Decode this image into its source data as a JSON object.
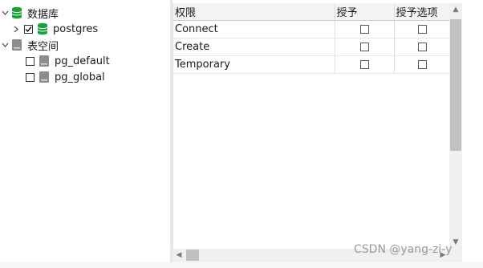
{
  "tree": {
    "databases": {
      "label": "数据库"
    },
    "postgres": {
      "label": "postgres",
      "checked": true
    },
    "tablespaces": {
      "label": "表空间"
    },
    "pg_default": {
      "label": "pg_default",
      "checked": false
    },
    "pg_global": {
      "label": "pg_global",
      "checked": false
    }
  },
  "grid": {
    "columns": [
      "权限",
      "授予",
      "授予选项"
    ],
    "rows": [
      {
        "privilege": "Connect",
        "grant": false,
        "grant_option": false
      },
      {
        "privilege": "Create",
        "grant": false,
        "grant_option": false
      },
      {
        "privilege": "Temporary",
        "grant": false,
        "grant_option": false
      }
    ]
  },
  "colors": {
    "db_icon": "#1aa33a",
    "tablespace_icon": "#8c8c8c"
  },
  "watermark": "CSDN @yang-zi-y"
}
